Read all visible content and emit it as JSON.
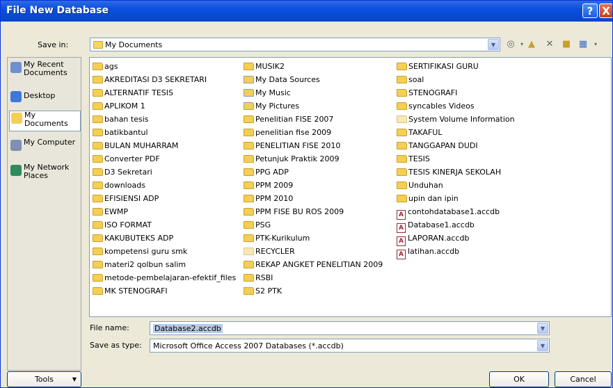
{
  "window": {
    "title": "File New Database",
    "help_label": "?",
    "close_label": "X"
  },
  "save_in": {
    "label": "Save in:",
    "value": "My Documents"
  },
  "places": [
    {
      "label": "My Recent Documents",
      "icon": "recent-docs-icon"
    },
    {
      "label": "Desktop",
      "icon": "desktop-icon"
    },
    {
      "label": "My Documents",
      "icon": "my-documents-icon"
    },
    {
      "label": "My Computer",
      "icon": "my-computer-icon"
    },
    {
      "label": "My Network Places",
      "icon": "network-places-icon"
    }
  ],
  "files": {
    "col1": [
      "ags",
      "AKREDITASI D3 SEKRETARI",
      "ALTERNATIF TESIS",
      "APLIKOM 1",
      "bahan tesis",
      "batikbantul",
      "BULAN MUHARRAM",
      "Converter PDF",
      "D3 Sekretari",
      "downloads",
      "EFISIENSI ADP",
      "EWMP",
      "ISO FORMAT",
      "KAKUBUTEKS ADP",
      "kompetensi guru smk",
      "materi2 qolbun salim",
      "metode-pembelajaran-efektif_files",
      "MK STENOGRAFI"
    ],
    "col2": [
      "MUSIK2",
      "My Data Sources",
      "My Music",
      "My Pictures",
      "Penelitian FISE 2007",
      "penelitian fise 2009",
      "PENELITIAN FISE 2010",
      "Petunjuk Praktik 2009",
      "PPG ADP",
      "PPM 2009",
      "PPM 2010",
      "PPM FISE BU ROS 2009",
      "PSG",
      "PTK-Kurikulum",
      "RECYCLER",
      "REKAP ANGKET PENELITIAN 2009",
      "RSBI",
      "S2 PTK"
    ],
    "col3": [
      "SERTIFIKASI GURU",
      "soal",
      "STENOGRAFI",
      "syncables Videos",
      "System Volume Information",
      "TAKAFUL",
      "TANGGAPAN DUDI",
      "TESIS",
      "TESIS KINERJA SEKOLAH",
      "Unduhan",
      "upin dan ipin"
    ],
    "col3_db": [
      "contohdatabase1.accdb",
      "Database1.accdb",
      "LAPORAN.accdb",
      "latihan.accdb"
    ]
  },
  "file_name": {
    "label": "File name:",
    "value": "Database2.accdb"
  },
  "save_as_type": {
    "label": "Save as type:",
    "value": "Microsoft Office Access 2007 Databases (*.accdb)"
  },
  "buttons": {
    "tools": "Tools",
    "ok": "OK",
    "cancel": "Cancel"
  },
  "colors": {
    "titlebar": "#0a4fdc",
    "dialog_bg": "#ece9d8",
    "folder": "#f4cf53"
  }
}
